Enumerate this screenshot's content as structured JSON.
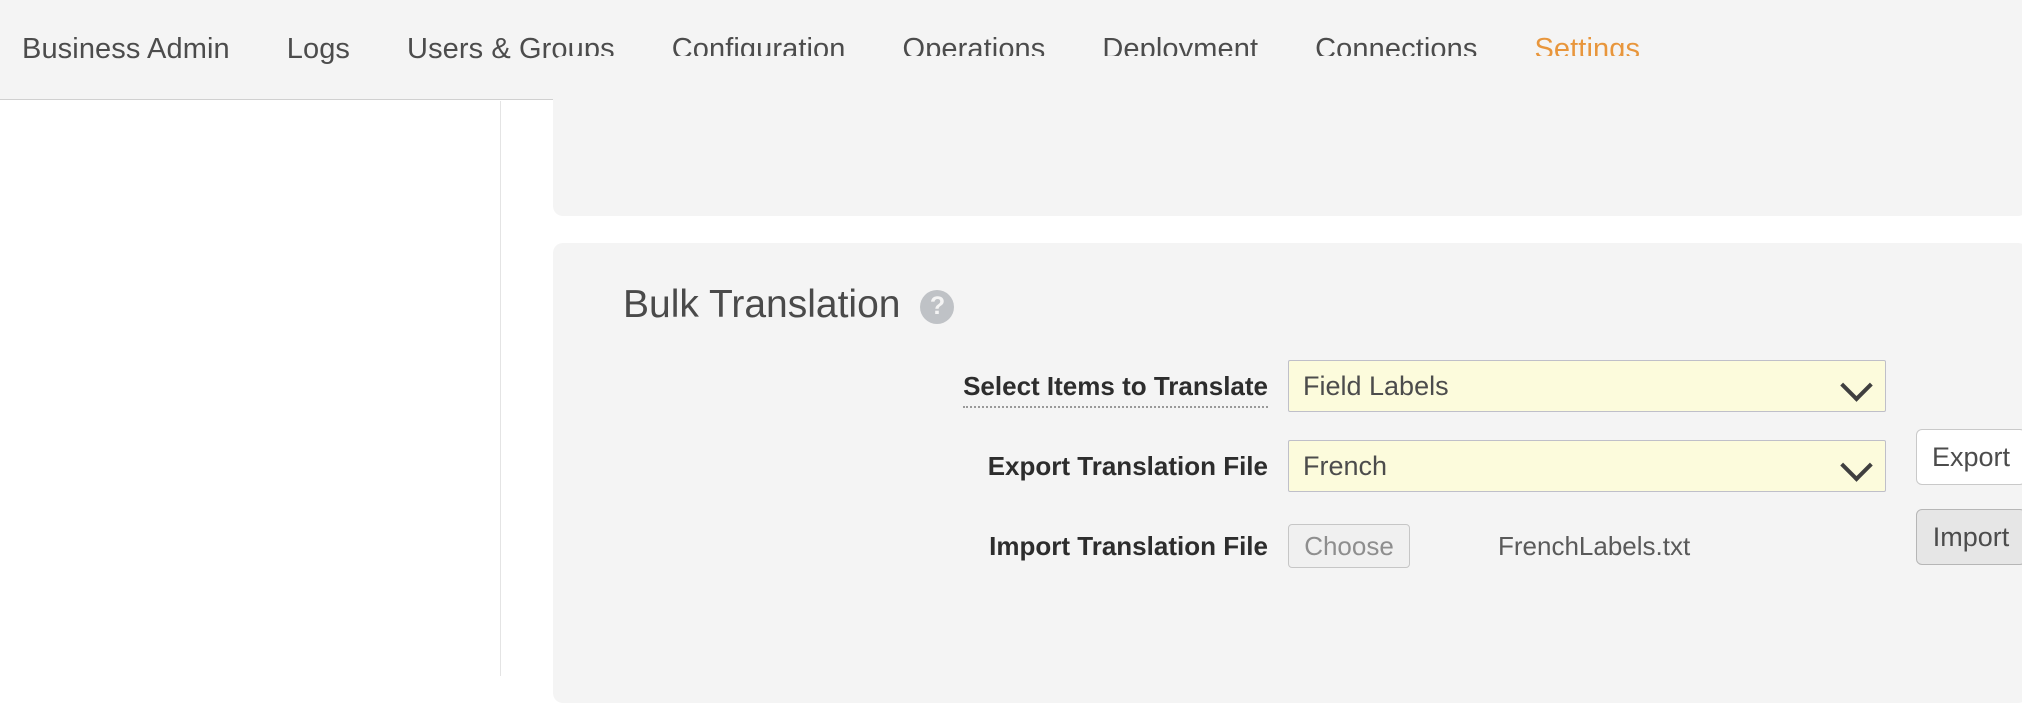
{
  "nav": {
    "items": [
      {
        "label": "Business Admin",
        "active": false
      },
      {
        "label": "Logs",
        "active": false
      },
      {
        "label": "Users & Groups",
        "active": false
      },
      {
        "label": "Configuration",
        "active": false
      },
      {
        "label": "Operations",
        "active": false
      },
      {
        "label": "Deployment",
        "active": false
      },
      {
        "label": "Connections",
        "active": false
      },
      {
        "label": "Settings",
        "active": true
      }
    ],
    "active_label": "Settings",
    "active_color": "#e8963c",
    "text_color": "#4c4c4c",
    "background": "#f4f4f4"
  },
  "panel": {
    "title": "Bulk Translation",
    "help_icon": "help-question-icon",
    "help_glyph": "?",
    "background": "#f4f4f4"
  },
  "form": {
    "rows": [
      {
        "label": "Select Items to Translate",
        "label_has_tooltip": true,
        "control": "select",
        "value": "Field Labels",
        "chevron": "chevron-down-icon",
        "action": null
      },
      {
        "label": "Export Translation File",
        "label_has_tooltip": false,
        "control": "select",
        "value": "French",
        "chevron": "chevron-down-icon",
        "action": "Export"
      },
      {
        "label": "Import Translation File",
        "label_has_tooltip": false,
        "control": "file",
        "choose_label": "Choose",
        "value": "FrenchLabels.txt",
        "action": "Import"
      }
    ],
    "select_fill": "#fcfbdc",
    "select_border": "#bfbfc9"
  },
  "buttons": {
    "export": "Export",
    "import": "Import"
  }
}
